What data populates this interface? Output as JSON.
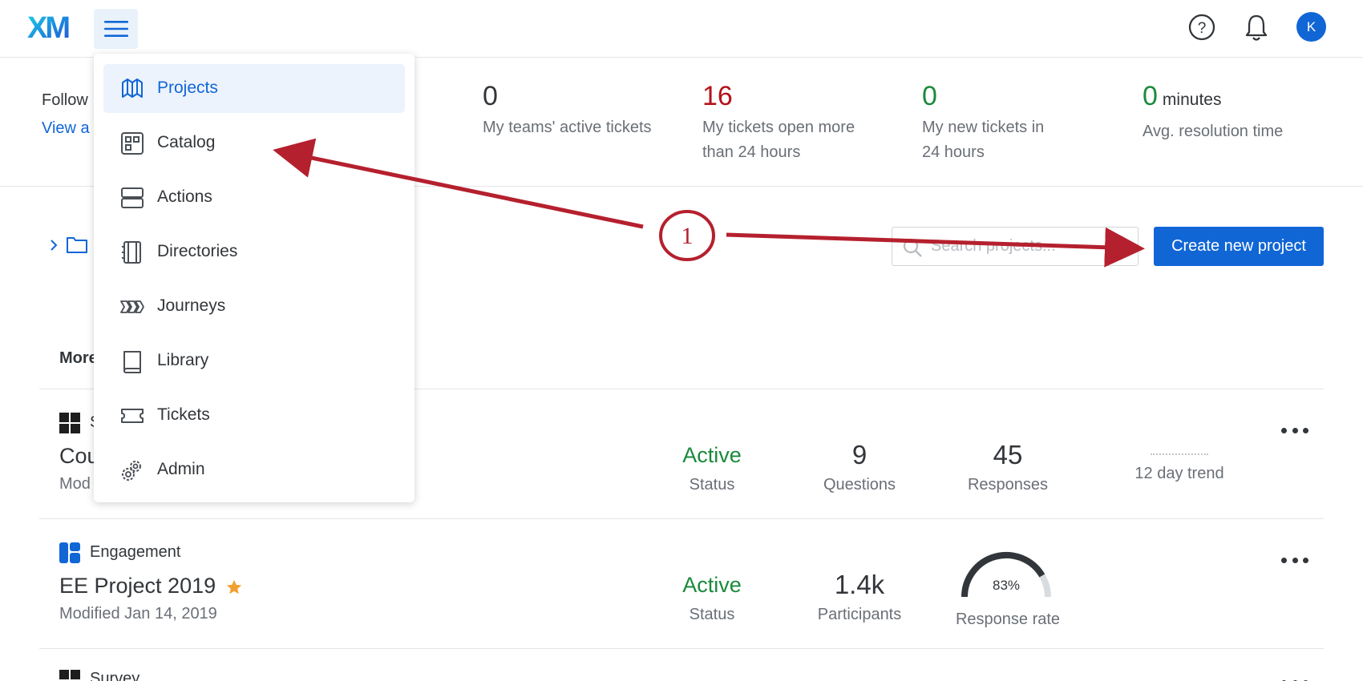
{
  "header": {
    "logo_text": "XM",
    "menu_icon": "hamburger-menu-icon",
    "help_icon": "help-circle-icon",
    "bell_icon": "bell-icon",
    "avatar_initial": "K"
  },
  "stats": {
    "follow_text": "Follow",
    "view_link": "View a",
    "items": [
      {
        "value": "0",
        "unit": "",
        "label": "My teams' active tickets",
        "color": "#32363a"
      },
      {
        "value": "16",
        "unit": "",
        "label": "My tickets open more than 24 hours",
        "color": "#b5121b"
      },
      {
        "value": "0",
        "unit": "",
        "label": "My new tickets in 24 hours",
        "color": "#1b8a3c"
      },
      {
        "value": "0",
        "unit": "minutes",
        "label": "Avg. resolution time",
        "color": "#1b8a3c"
      }
    ]
  },
  "toolbar": {
    "search_placeholder": "Search projects...",
    "create_label": "Create new project"
  },
  "list": {
    "section_title": "More",
    "projects": [
      {
        "type_label": "S",
        "type_icon": "survey-icon",
        "name": "Cou",
        "modified": "Mod",
        "starred": false,
        "metrics": [
          {
            "value": "Active",
            "label": "Status"
          },
          {
            "value": "9",
            "label": "Questions"
          },
          {
            "value": "45",
            "label": "Responses"
          },
          {
            "value": "",
            "label": "12 day trend"
          }
        ]
      },
      {
        "type_label": "Engagement",
        "type_icon": "engagement-icon",
        "name": "EE Project 2019",
        "modified": "Modified Jan 14, 2019",
        "starred": true,
        "metrics": [
          {
            "value": "Active",
            "label": "Status"
          },
          {
            "value": "1.4k",
            "label": "Participants"
          },
          {
            "value": "83%",
            "label": "Response rate",
            "fraction": 0.83
          }
        ]
      },
      {
        "type_label": "Survey",
        "type_icon": "survey-icon"
      }
    ]
  },
  "nav_menu": {
    "items": [
      {
        "label": "Projects",
        "icon": "projects-icon",
        "selected": true
      },
      {
        "label": "Catalog",
        "icon": "catalog-icon",
        "selected": false
      },
      {
        "label": "Actions",
        "icon": "actions-icon",
        "selected": false
      },
      {
        "label": "Directories",
        "icon": "directories-icon",
        "selected": false
      },
      {
        "label": "Journeys",
        "icon": "journeys-icon",
        "selected": false
      },
      {
        "label": "Library",
        "icon": "library-icon",
        "selected": false
      },
      {
        "label": "Tickets",
        "icon": "tickets-icon",
        "selected": false
      },
      {
        "label": "Admin",
        "icon": "admin-gear-icon",
        "selected": false
      }
    ]
  },
  "annotation": {
    "step_number": "1",
    "color": "#b5202e"
  },
  "colors": {
    "accent": "#1166d6",
    "active_green": "#1b8a3c",
    "alert_red": "#b5121b",
    "star_orange": "#f0a030"
  }
}
